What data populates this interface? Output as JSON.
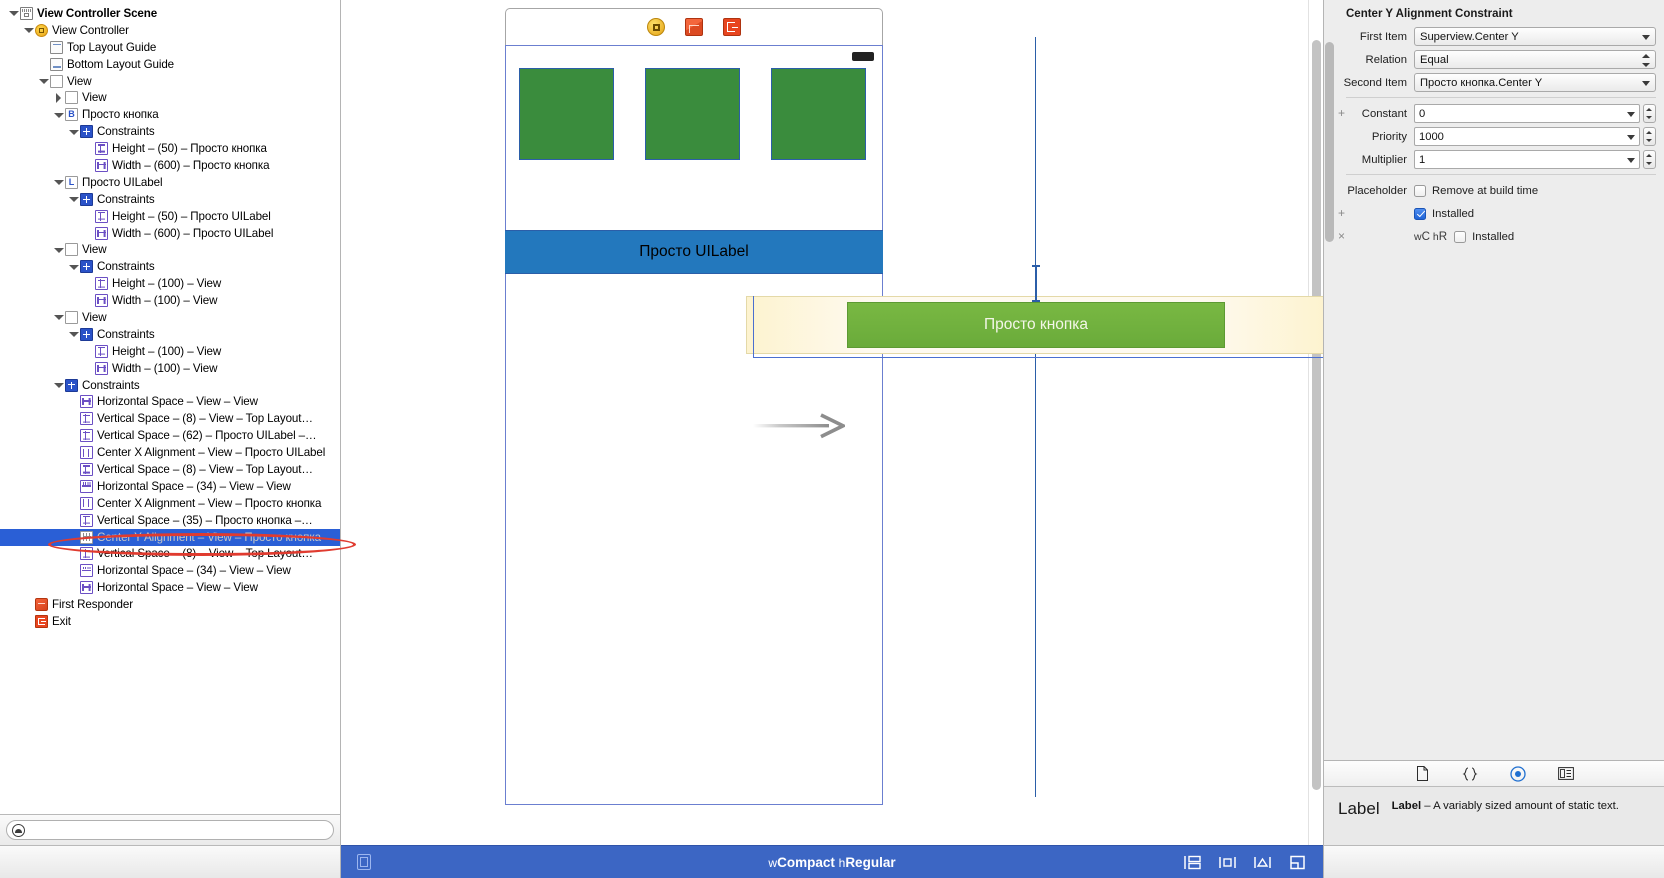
{
  "outline": {
    "items": [
      {
        "label": "View Controller Scene",
        "indent": 0,
        "icon": "scene",
        "disclose": "open",
        "bold": true
      },
      {
        "label": "View Controller",
        "indent": 1,
        "icon": "vc",
        "disclose": "open"
      },
      {
        "label": "Top Layout Guide",
        "indent": 2,
        "icon": "guide-top",
        "disclose": "none"
      },
      {
        "label": "Bottom Layout Guide",
        "indent": 2,
        "icon": "guide-bottom",
        "disclose": "none"
      },
      {
        "label": "View",
        "indent": 2,
        "icon": "view",
        "disclose": "open"
      },
      {
        "label": "View",
        "indent": 3,
        "icon": "view",
        "disclose": "closed"
      },
      {
        "label": "Просто кнопка",
        "indent": 3,
        "icon": "button",
        "disclose": "open"
      },
      {
        "label": "Constraints",
        "indent": 4,
        "icon": "constraints-folder",
        "disclose": "open"
      },
      {
        "label": "Height – (50) – Просто кнопка",
        "indent": 5,
        "icon": "constraint-vertical",
        "disclose": "none"
      },
      {
        "label": "Width – (600) – Просто кнопка",
        "indent": 5,
        "icon": "constraint-horizontal",
        "disclose": "none"
      },
      {
        "label": "Просто UILabel",
        "indent": 3,
        "icon": "label",
        "disclose": "open"
      },
      {
        "label": "Constraints",
        "indent": 4,
        "icon": "constraints-folder",
        "disclose": "open"
      },
      {
        "label": "Height – (50) – Просто UILabel",
        "indent": 5,
        "icon": "constraint-vertical",
        "disclose": "none"
      },
      {
        "label": "Width – (600) – Просто UILabel",
        "indent": 5,
        "icon": "constraint-horizontal",
        "disclose": "none"
      },
      {
        "label": "View",
        "indent": 3,
        "icon": "view",
        "disclose": "open"
      },
      {
        "label": "Constraints",
        "indent": 4,
        "icon": "constraints-folder",
        "disclose": "open"
      },
      {
        "label": "Height – (100) – View",
        "indent": 5,
        "icon": "constraint-vertical",
        "disclose": "none"
      },
      {
        "label": "Width – (100) – View",
        "indent": 5,
        "icon": "constraint-horizontal",
        "disclose": "none"
      },
      {
        "label": "View",
        "indent": 3,
        "icon": "view",
        "disclose": "open"
      },
      {
        "label": "Constraints",
        "indent": 4,
        "icon": "constraints-folder",
        "disclose": "open"
      },
      {
        "label": "Height – (100) – View",
        "indent": 5,
        "icon": "constraint-vertical",
        "disclose": "none"
      },
      {
        "label": "Width – (100) – View",
        "indent": 5,
        "icon": "constraint-horizontal",
        "disclose": "none"
      },
      {
        "label": "Constraints",
        "indent": 3,
        "icon": "constraints-folder",
        "disclose": "open"
      },
      {
        "label": "Horizontal Space – View – View",
        "indent": 4,
        "icon": "constraint-hspace-plain",
        "disclose": "none"
      },
      {
        "label": "Vertical Space – (8) – View – Top Layout…",
        "indent": 4,
        "icon": "constraint-vertical",
        "disclose": "none"
      },
      {
        "label": "Vertical Space – (62) – Просто UILabel –…",
        "indent": 4,
        "icon": "constraint-vertical",
        "disclose": "none"
      },
      {
        "label": "Center X Alignment – View – Просто UILabel",
        "indent": 4,
        "icon": "constraint-centerx",
        "disclose": "none"
      },
      {
        "label": "Vertical Space – (8) – View – Top Layout…",
        "indent": 4,
        "icon": "constraint-vertical",
        "disclose": "none"
      },
      {
        "label": "Horizontal Space – (34) – View – View",
        "indent": 4,
        "icon": "constraint-hspace",
        "disclose": "none"
      },
      {
        "label": "Center X Alignment – View – Просто кнопка",
        "indent": 4,
        "icon": "constraint-centerx",
        "disclose": "none"
      },
      {
        "label": "Vertical Space – (35) – Просто кнопка –…",
        "indent": 4,
        "icon": "constraint-vertical",
        "disclose": "none"
      },
      {
        "label": "Center Y Alignment – View – Просто кнопка",
        "indent": 4,
        "icon": "constraint-centery",
        "disclose": "none",
        "selected": true
      },
      {
        "label": "Vertical Space – (8) – View – Top Layout…",
        "indent": 4,
        "icon": "constraint-vertical",
        "disclose": "none"
      },
      {
        "label": "Horizontal Space – (34) – View – View",
        "indent": 4,
        "icon": "constraint-hspace",
        "disclose": "none"
      },
      {
        "label": "Horizontal Space – View – View",
        "indent": 4,
        "icon": "constraint-hspace-plain",
        "disclose": "none"
      },
      {
        "label": "First Responder",
        "indent": 1,
        "icon": "first-responder",
        "disclose": "none"
      },
      {
        "label": "Exit",
        "indent": 1,
        "icon": "exit",
        "disclose": "none"
      }
    ],
    "filter_placeholder": ""
  },
  "canvas": {
    "dock_icons": [
      "view-controller-icon",
      "first-responder-icon",
      "exit-icon"
    ],
    "label_text": "Просто UILabel",
    "button_text": "Просто кнопка"
  },
  "inspector": {
    "title": "Center Y Alignment Constraint",
    "first_item_label": "First Item",
    "first_item_value": "Superview.Center Y",
    "relation_label": "Relation",
    "relation_value": "Equal",
    "second_item_label": "Second Item",
    "second_item_value": "Просто кнопка.Center Y",
    "constant_label": "Constant",
    "constant_value": "0",
    "priority_label": "Priority",
    "priority_value": "1000",
    "multiplier_label": "Multiplier",
    "multiplier_value": "1",
    "placeholder_label": "Placeholder",
    "placeholder_text": "Remove at build time",
    "installed_label": "Installed",
    "variation_prefix_w": "w",
    "variation_prefix_wc": "C",
    "variation_prefix_h": "h",
    "variation_prefix_hr": "R",
    "variation_installed_label": "Installed",
    "plus_symbol": "+",
    "minus_symbol": "×",
    "library": {
      "tabs": [
        "file-inspector-icon",
        "code-snippet-icon",
        "object-library-icon",
        "media-library-icon"
      ],
      "item_title": "Label",
      "item_name": "Label",
      "item_desc": "– A variably sized amount of static text."
    }
  },
  "bottombar": {
    "size_class_w_prefix": "w",
    "size_class_w": "Compact",
    "size_class_h_prefix": "h",
    "size_class_h": "Regular",
    "icons": [
      "assistant-editor-icon",
      "align-icon",
      "pin-icon",
      "resolve-icon"
    ]
  },
  "colors": {
    "selection_blue": "#2a5fd6",
    "annotation_red": "#e03b2f",
    "label_blue": "#2378bd",
    "button_green": "#79b843",
    "square_green": "#3a8c3d",
    "bottom_bar_blue": "#3c66c4"
  }
}
